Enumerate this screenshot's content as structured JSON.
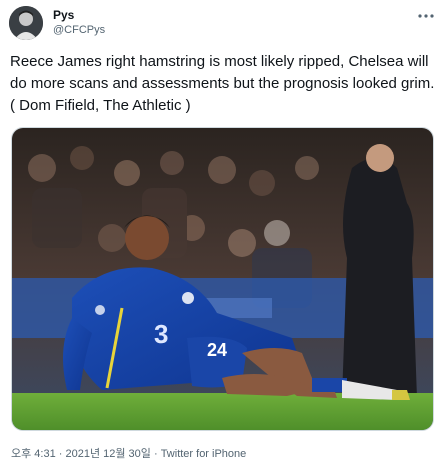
{
  "tweet": {
    "display_name": "Pys",
    "handle": "@CFCPys",
    "more_icon": "more-horizontal-icon",
    "text": "Reece James right hamstring is most likely ripped, Chelsea will do more scans and assessments but the prognosis looked grim. ( Dom Fifield, The Athletic )",
    "timestamp": "오후 4:31 · 2021년 12월 30일",
    "separator": " · ",
    "source": "Twitter for iPhone"
  },
  "photo": {
    "shirt_number": "24",
    "shirt_sponsor": "3"
  }
}
